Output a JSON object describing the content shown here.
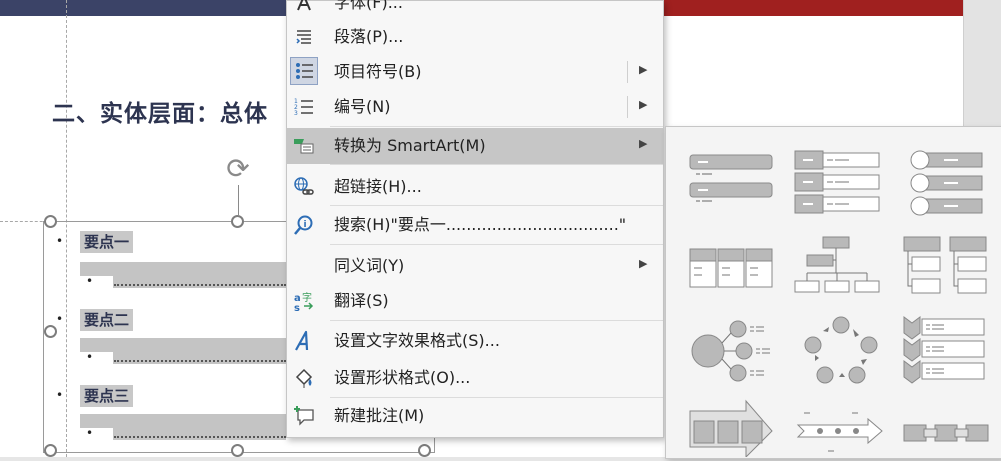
{
  "slide": {
    "title": "二、实体层面：总体",
    "key_points": [
      "要点一",
      "要点二",
      "要点三"
    ]
  },
  "context_menu": {
    "items": [
      {
        "label": "字体(F)...",
        "icon": "font-icon",
        "submenu": false
      },
      {
        "label": "段落(P)...",
        "icon": "paragraph-icon",
        "submenu": false
      },
      {
        "label": "项目符号(B)",
        "icon": "bullets-icon",
        "submenu": true
      },
      {
        "label": "编号(N)",
        "icon": "numbering-icon",
        "submenu": true
      },
      {
        "label": "转换为 SmartArt(M)",
        "icon": "smartart-convert-icon",
        "submenu": true,
        "highlighted": true
      },
      {
        "label": "超链接(H)...",
        "icon": "hyperlink-icon",
        "submenu": false
      },
      {
        "label": "搜索(H)\"要点一..................................\"",
        "icon": "search-icon",
        "submenu": false
      },
      {
        "label": "同义词(Y)",
        "icon": "",
        "submenu": true
      },
      {
        "label": "翻译(S)",
        "icon": "translate-icon",
        "submenu": false
      },
      {
        "label": "设置文字效果格式(S)...",
        "icon": "text-effects-icon",
        "submenu": false
      },
      {
        "label": "设置形状格式(O)...",
        "icon": "shape-format-icon",
        "submenu": false
      },
      {
        "label": "新建批注(M)",
        "icon": "new-comment-icon",
        "submenu": false
      }
    ]
  },
  "smartart_submenu": {
    "layouts": [
      "vertical-bullet-list",
      "stacked-list",
      "circle-list",
      "horizontal-table-list",
      "org-chart",
      "hierarchy-list",
      "radial-list",
      "cycle-process",
      "chevron-list",
      "arrow-process",
      "timeline-process",
      "linked-process"
    ]
  },
  "colors": {
    "title": "#2d3450",
    "header_band_left": "#3b4367",
    "header_band_right": "#a0201f",
    "menu_highlight": "#c6c6c6",
    "thumbnail_fill": "#b9b9b9"
  }
}
